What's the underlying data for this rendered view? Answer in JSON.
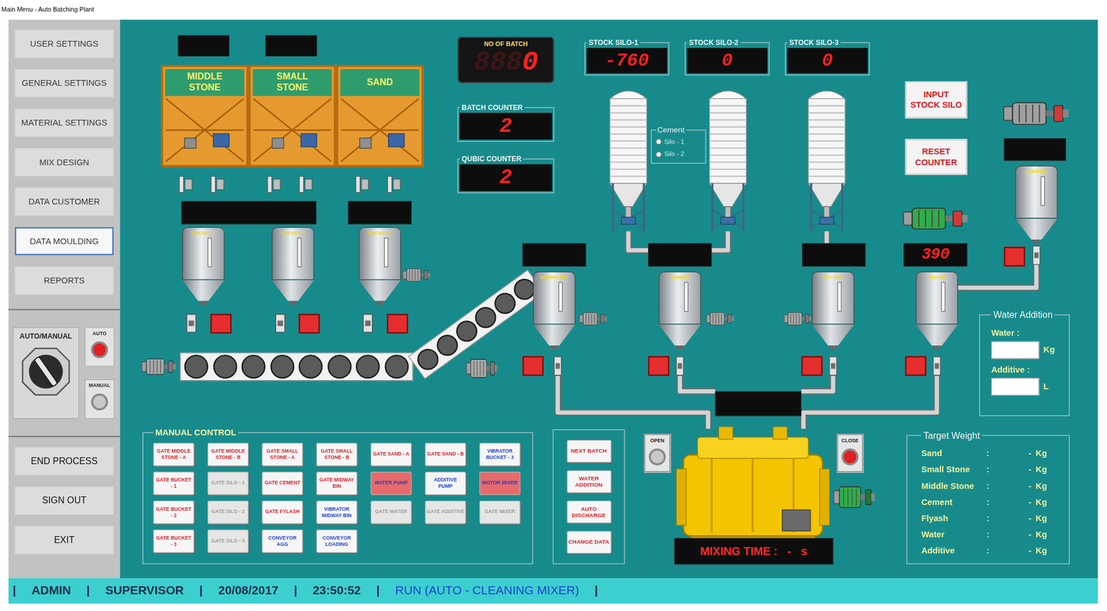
{
  "window": {
    "title": "Main Menu - Auto Batching Plant"
  },
  "sidebar": {
    "items": [
      {
        "label": "USER SETTINGS",
        "selected": false
      },
      {
        "label": "GENERAL SETTINGS",
        "selected": false
      },
      {
        "label": "MATERIAL SETTINGS",
        "selected": false
      },
      {
        "label": "MIX DESIGN",
        "selected": false
      },
      {
        "label": "DATA CUSTOMER",
        "selected": false
      },
      {
        "label": "DATA MOULDING",
        "selected": true
      },
      {
        "label": "REPORTS",
        "selected": false
      }
    ],
    "mode": {
      "label": "AUTO/MANUAL",
      "options": [
        {
          "label": "AUTO",
          "on": true
        },
        {
          "label": "MANUAL",
          "on": false
        }
      ]
    },
    "actions": [
      "END PROCESS",
      "SIGN OUT",
      "EXIT"
    ]
  },
  "hoppers": [
    {
      "label": "MIDDLE STONE"
    },
    {
      "label": "SMALL STONE"
    },
    {
      "label": "SAND"
    }
  ],
  "buckets": [
    {
      "label": "BUCKET 1",
      "gate_open": false
    },
    {
      "label": "BUCKET 2",
      "gate_open": false
    },
    {
      "label": "BUCKET 3",
      "gate_open": false
    }
  ],
  "counters": {
    "no_of_batch": {
      "label": "NO OF BATCH",
      "ghost": "888",
      "value": "0"
    },
    "batch": {
      "label": "BATCH COUNTER",
      "value": "2"
    },
    "qubic": {
      "label": "QUBIC COUNTER",
      "value": "2"
    }
  },
  "stock_silos": [
    {
      "label": "STOCK SILO-1",
      "value": "-760"
    },
    {
      "label": "STOCK SILO-2",
      "value": "0"
    },
    {
      "label": "STOCK SILO-3",
      "value": "0"
    }
  ],
  "cement_select": {
    "title": "Cement",
    "options": [
      {
        "label": "Silo - 1",
        "selected": false
      },
      {
        "label": "Silo - 2",
        "selected": false
      }
    ]
  },
  "controls": {
    "input_stock_silo": "INPUT STOCK SILO",
    "reset_counter": "RESET COUNTER"
  },
  "bins": [
    {
      "label": "MIDWAY BIN",
      "gate_open": false
    },
    {
      "label": "CEMENT",
      "gate_open": false
    },
    {
      "label": "FLY ASH",
      "gate_open": false
    },
    {
      "label": "WATER",
      "reading": "390",
      "gate_open": false
    }
  ],
  "additive": {
    "label": "ADDITIVE",
    "gate_open": false
  },
  "mixer": {
    "open": {
      "label": "OPEN",
      "on": false
    },
    "close": {
      "label": "CLOSE",
      "on": true
    },
    "mixing_time": {
      "label": "MIXING TIME :",
      "value": "-",
      "unit": "s"
    }
  },
  "manual_control": {
    "title": "MANUAL CONTROL",
    "buttons": [
      {
        "label": "GATE MIDDLE STONE - A",
        "kind": "gate",
        "on": false,
        "disabled": false
      },
      {
        "label": "GATE MIDDLE STONE - B",
        "kind": "gate",
        "on": false,
        "disabled": false
      },
      {
        "label": "GATE SMALL STONE - A",
        "kind": "gate",
        "on": false,
        "disabled": false
      },
      {
        "label": "GATE SMALL STONE - B",
        "kind": "gate",
        "on": false,
        "disabled": false
      },
      {
        "label": "GATE SAND - A",
        "kind": "gate",
        "on": false,
        "disabled": false
      },
      {
        "label": "GATE SAND - B",
        "kind": "gate",
        "on": false,
        "disabled": false
      },
      {
        "label": "VIBRATOR BUCKET - 3",
        "kind": "motor",
        "on": false,
        "disabled": false
      },
      {
        "label": "GATE BUCKET - 1",
        "kind": "gate",
        "on": false,
        "disabled": false
      },
      {
        "label": "GATE SILO - 1",
        "kind": "gate",
        "on": false,
        "disabled": true
      },
      {
        "label": "GATE CEMENT",
        "kind": "gate",
        "on": false,
        "disabled": false
      },
      {
        "label": "GATE MIDWAY BIN",
        "kind": "gate",
        "on": false,
        "disabled": false
      },
      {
        "label": "WATER PUMP",
        "kind": "motor",
        "on": true,
        "disabled": false
      },
      {
        "label": "ADDITIVE PUMP",
        "kind": "motor",
        "on": false,
        "disabled": false
      },
      {
        "label": "MOTOR MIXER",
        "kind": "motor",
        "on": true,
        "disabled": false
      },
      {
        "label": "GATE BUCKET - 2",
        "kind": "gate",
        "on": false,
        "disabled": false
      },
      {
        "label": "GATE SILO - 2",
        "kind": "gate",
        "on": false,
        "disabled": true
      },
      {
        "label": "GATE FYLASH",
        "kind": "gate",
        "on": false,
        "disabled": false
      },
      {
        "label": "VIBRATOR MIDWAY BIN",
        "kind": "motor",
        "on": false,
        "disabled": false
      },
      {
        "label": "GATE WATER",
        "kind": "gate",
        "on": false,
        "disabled": true
      },
      {
        "label": "GATE ADDITIVE",
        "kind": "gate",
        "on": false,
        "disabled": true
      },
      {
        "label": "GATE MIXER",
        "kind": "gate",
        "on": false,
        "disabled": true
      },
      {
        "label": "GATE BUCKET - 3",
        "kind": "gate",
        "on": false,
        "disabled": false
      },
      {
        "label": "GATE SILO - 3",
        "kind": "gate",
        "on": false,
        "disabled": true
      },
      {
        "label": "CONVEYOR AGG",
        "kind": "motor",
        "on": false,
        "disabled": false
      },
      {
        "label": "CONVEYOR LOADING",
        "kind": "motor",
        "on": false,
        "disabled": false
      }
    ]
  },
  "process_buttons": [
    "NEXT BATCH",
    "WATER ADDITION",
    "AUTO DISCHARGE",
    "CHANGE DATA"
  ],
  "water_addition": {
    "title": "Water Addition",
    "fields": [
      {
        "label": "Water :",
        "value": "",
        "unit": "Kg"
      },
      {
        "label": "Additive :",
        "value": "",
        "unit": "L"
      }
    ]
  },
  "target_weight": {
    "title": "Target Weight",
    "rows": [
      {
        "label": "Sand",
        "separator": ":",
        "value": "-",
        "unit": "Kg"
      },
      {
        "label": "Small Stone",
        "separator": ":",
        "value": "-",
        "unit": "Kg"
      },
      {
        "label": "Middle Stone",
        "separator": ":",
        "value": "-",
        "unit": "Kg"
      },
      {
        "label": "Cement",
        "separator": ":",
        "value": "-",
        "unit": "Kg"
      },
      {
        "label": "Flyash",
        "separator": ":",
        "value": "-",
        "unit": "Kg"
      },
      {
        "label": "Water",
        "separator": ":",
        "value": "-",
        "unit": "Kg"
      },
      {
        "label": "Additive",
        "separator": ":",
        "value": "-",
        "unit": "Kg"
      }
    ]
  },
  "status_bar": {
    "separator": "|",
    "items": [
      {
        "text": "ADMIN",
        "highlight": false
      },
      {
        "text": "SUPERVISOR",
        "highlight": false
      },
      {
        "text": "20/08/2017",
        "highlight": false
      },
      {
        "text": "23:50:52",
        "highlight": false
      },
      {
        "text": "RUN (AUTO - CLEANING MIXER)",
        "highlight": true
      }
    ]
  }
}
